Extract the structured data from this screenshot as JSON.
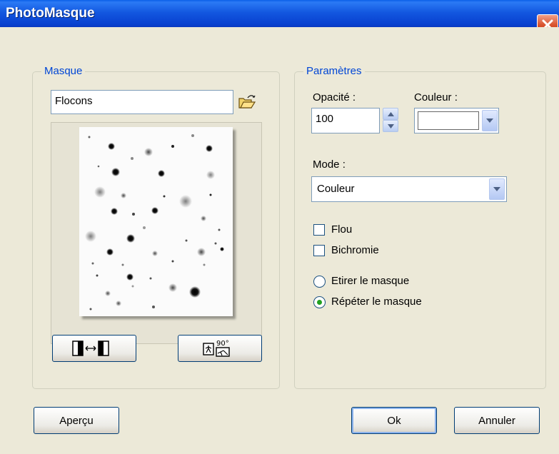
{
  "window": {
    "title": "PhotoMasque",
    "close_icon": "close-icon"
  },
  "masque": {
    "legend": "Masque",
    "file_value": "Flocons",
    "browse_icon": "open-folder-icon",
    "swap_icon": "swap-mask-icon",
    "rotate_icon": "rotate-90-icon",
    "rotate_label": "90°"
  },
  "parametres": {
    "legend": "Paramètres",
    "opacity_label": "Opacité :",
    "opacity_value": "100",
    "color_label": "Couleur :",
    "color_value": "#ffffff",
    "mode_label": "Mode :",
    "mode_value": "Couleur",
    "flou_label": "Flou",
    "flou_checked": false,
    "bichromie_label": "Bichromie",
    "bichromie_checked": false,
    "radio_stretch_label": "Etirer le masque",
    "radio_repeat_label": "Répéter le masque",
    "selected_mode": "repeat"
  },
  "buttons": {
    "preview": "Aperçu",
    "ok": "Ok",
    "cancel": "Annuler"
  },
  "colors": {
    "dialog_bg": "#ece9d8",
    "title_blue": "#0a3ac0",
    "legend_blue": "#0046d5",
    "radio_green": "#21a121"
  }
}
